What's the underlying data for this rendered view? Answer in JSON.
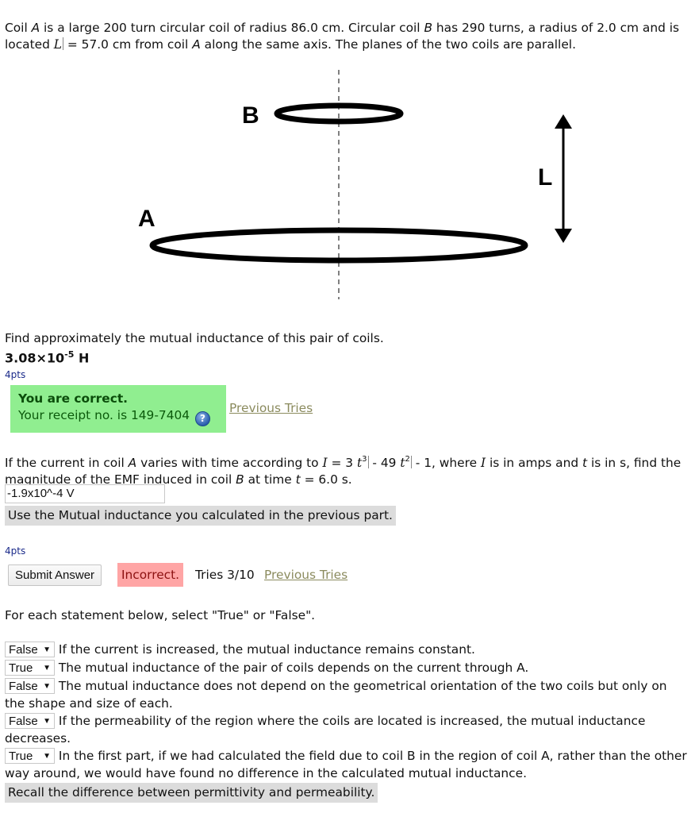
{
  "problem": {
    "intro_part1": "Coil ",
    "coil_a": "A",
    "intro_part2": " is a large 200 turn circular coil of radius 86.0 cm. Circular coil ",
    "coil_b": "B",
    "intro_part3": " has 290 turns, a radius of 2.0 cm and is located ",
    "L_symbol": "L",
    "intro_part4": " = 57.0 cm from coil ",
    "intro_part5": " along the same axis. The planes of the two coils are parallel."
  },
  "diagram": {
    "label_b": "B",
    "label_a": "A",
    "label_l": "L"
  },
  "part1": {
    "question": "Find approximately the mutual inductance of this pair of coils.",
    "answer_mantissa": "3.08×10",
    "answer_exponent": "-5",
    "answer_unit": " H",
    "points": "4pts",
    "status_title": "You are correct.",
    "receipt_text": "Your receipt no. is 149-7404",
    "help_icon": "?",
    "previous_tries": "Previous Tries",
    "status_color": "#90ee90"
  },
  "part2": {
    "q_part1": "If the current in coil ",
    "coil_a": "A",
    "q_part2": " varies with time according to ",
    "I_symbol": "I",
    "q_part3": " = 3 ",
    "t_symbol": "t",
    "exp3": "3",
    "q_part4": " - 49 ",
    "exp2": "2",
    "q_part5": " - 1, where ",
    "q_part6": " is in amps and ",
    "q_part7": " is in s, find the magnitude of the EMF induced in coil ",
    "coil_b": "B",
    "q_part8": " at time ",
    "q_part9": " = 6.0 s.",
    "input_value": "-1.9x10^-4 V",
    "hint": "Use the Mutual inductance you calculated in the previous part.",
    "points": "4pts",
    "submit_label": "Submit Answer",
    "status": "Incorrect.",
    "tries": "Tries 3/10",
    "previous_tries": "Previous Tries",
    "status_color": "#ffa5a5"
  },
  "part3": {
    "instruction": "For each statement below, select \"True\" or \"False\".",
    "statements": [
      {
        "selected": "False",
        "text": "If the current is increased, the mutual inductance remains constant."
      },
      {
        "selected": "True",
        "text": "The mutual inductance of the pair of coils depends on the current through A."
      },
      {
        "selected": "False",
        "text": "The mutual inductance does not depend on the geometrical orientation of the two coils but only on the shape and size of each."
      },
      {
        "selected": "False",
        "text": "If the permeability of the region where the coils are located is increased, the mutual inductance decreases."
      },
      {
        "selected": "True",
        "text": "In the first part, if we had calculated the field due to coil B in the region of coil A, rather than the other way around, we would have found no difference in the calculated mutual inductance."
      }
    ],
    "hint": "Recall the difference between permittivity and permeability."
  }
}
